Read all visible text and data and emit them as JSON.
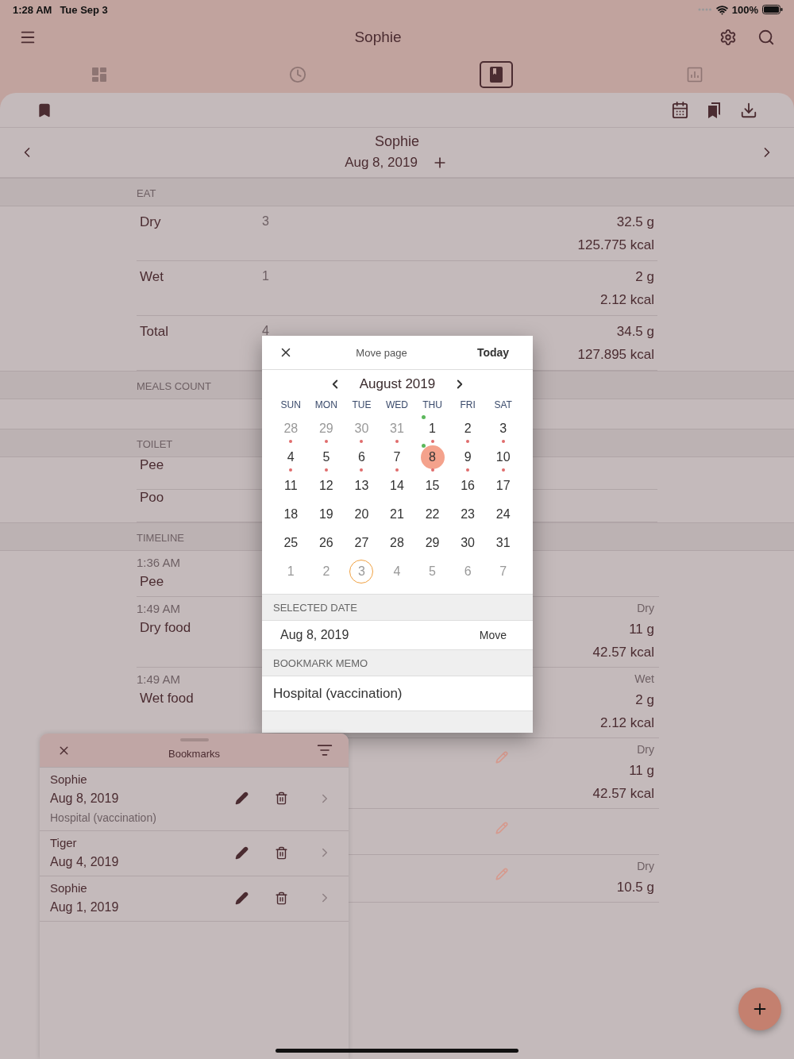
{
  "status_bar": {
    "time": "1:28 AM",
    "date": "Tue Sep 3",
    "battery": "100%"
  },
  "app_bar": {
    "title": "Sophie"
  },
  "tabs": [
    {
      "selected": false
    },
    {
      "selected": false
    },
    {
      "selected": true
    },
    {
      "selected": false
    }
  ],
  "date_header": {
    "name": "Sophie",
    "date": "Aug 8, 2019"
  },
  "sections": [
    {
      "title": "EAT",
      "kind": "food",
      "rows": [
        {
          "label": "Dry",
          "count": "3",
          "grams": "32.5 g",
          "kcal": "125.775 kcal"
        },
        {
          "label": "Wet",
          "count": "1",
          "grams": "2 g",
          "kcal": "2.12 kcal"
        },
        {
          "label": "Total",
          "count": "4",
          "grams": "34.5 g",
          "kcal": "127.895 kcal"
        }
      ]
    },
    {
      "title": "MEALS COUNT",
      "kind": "empty"
    },
    {
      "title": "TOILET",
      "kind": "list",
      "rows": [
        {
          "label": "Pee"
        },
        {
          "label": "Poo"
        }
      ]
    },
    {
      "title": "TIMELINE",
      "kind": "timeline",
      "entries": [
        {
          "time": "1:36 AM",
          "label": "Pee",
          "editable": false
        },
        {
          "time": "1:49 AM",
          "label": "Dry food",
          "type": "Dry",
          "grams": "11 g",
          "kcal": "42.57 kcal",
          "editable": false
        },
        {
          "time": "1:49 AM",
          "label": "Wet food",
          "type": "Wet",
          "grams": "2 g",
          "kcal": "2.12 kcal",
          "editable": false
        },
        {
          "type": "Dry",
          "grams": "11 g",
          "kcal": "42.57 kcal",
          "editable": true
        },
        {
          "editable": true
        },
        {
          "type": "Dry",
          "grams": "10.5 g",
          "editable": true
        }
      ]
    }
  ],
  "dialog": {
    "title": "Move page",
    "today_button": "Today",
    "month": "August 2019",
    "weekdays": [
      "SUN",
      "MON",
      "TUE",
      "WED",
      "THU",
      "FRI",
      "SAT"
    ],
    "days": [
      {
        "label": "28",
        "outside": true,
        "dot": true,
        "event": false,
        "today": false,
        "selected": false
      },
      {
        "label": "29",
        "outside": true,
        "dot": true,
        "event": false,
        "today": false,
        "selected": false
      },
      {
        "label": "30",
        "outside": true,
        "dot": true,
        "event": false,
        "today": false,
        "selected": false
      },
      {
        "label": "31",
        "outside": true,
        "dot": true,
        "event": false,
        "today": false,
        "selected": false
      },
      {
        "label": "1",
        "outside": false,
        "dot": true,
        "event": true,
        "today": false,
        "selected": false
      },
      {
        "label": "2",
        "outside": false,
        "dot": true,
        "event": false,
        "today": false,
        "selected": false
      },
      {
        "label": "3",
        "outside": false,
        "dot": true,
        "event": false,
        "today": false,
        "selected": false
      },
      {
        "label": "4",
        "outside": false,
        "dot": true,
        "event": false,
        "today": false,
        "selected": false
      },
      {
        "label": "5",
        "outside": false,
        "dot": true,
        "event": false,
        "today": false,
        "selected": false
      },
      {
        "label": "6",
        "outside": false,
        "dot": true,
        "event": false,
        "today": false,
        "selected": false
      },
      {
        "label": "7",
        "outside": false,
        "dot": true,
        "event": false,
        "today": false,
        "selected": false
      },
      {
        "label": "8",
        "outside": false,
        "dot": true,
        "event": true,
        "today": false,
        "selected": true
      },
      {
        "label": "9",
        "outside": false,
        "dot": true,
        "event": false,
        "today": false,
        "selected": false
      },
      {
        "label": "10",
        "outside": false,
        "dot": true,
        "event": false,
        "today": false,
        "selected": false
      },
      {
        "label": "11",
        "outside": false,
        "dot": false,
        "event": false,
        "today": false,
        "selected": false
      },
      {
        "label": "12",
        "outside": false,
        "dot": false,
        "event": false,
        "today": false,
        "selected": false
      },
      {
        "label": "13",
        "outside": false,
        "dot": false,
        "event": false,
        "today": false,
        "selected": false
      },
      {
        "label": "14",
        "outside": false,
        "dot": false,
        "event": false,
        "today": false,
        "selected": false
      },
      {
        "label": "15",
        "outside": false,
        "dot": false,
        "event": false,
        "today": false,
        "selected": false
      },
      {
        "label": "16",
        "outside": false,
        "dot": false,
        "event": false,
        "today": false,
        "selected": false
      },
      {
        "label": "17",
        "outside": false,
        "dot": false,
        "event": false,
        "today": false,
        "selected": false
      },
      {
        "label": "18",
        "outside": false,
        "dot": false,
        "event": false,
        "today": false,
        "selected": false
      },
      {
        "label": "19",
        "outside": false,
        "dot": false,
        "event": false,
        "today": false,
        "selected": false
      },
      {
        "label": "20",
        "outside": false,
        "dot": false,
        "event": false,
        "today": false,
        "selected": false
      },
      {
        "label": "21",
        "outside": false,
        "dot": false,
        "event": false,
        "today": false,
        "selected": false
      },
      {
        "label": "22",
        "outside": false,
        "dot": false,
        "event": false,
        "today": false,
        "selected": false
      },
      {
        "label": "23",
        "outside": false,
        "dot": false,
        "event": false,
        "today": false,
        "selected": false
      },
      {
        "label": "24",
        "outside": false,
        "dot": false,
        "event": false,
        "today": false,
        "selected": false
      },
      {
        "label": "25",
        "outside": false,
        "dot": false,
        "event": false,
        "today": false,
        "selected": false
      },
      {
        "label": "26",
        "outside": false,
        "dot": false,
        "event": false,
        "today": false,
        "selected": false
      },
      {
        "label": "27",
        "outside": false,
        "dot": false,
        "event": false,
        "today": false,
        "selected": false
      },
      {
        "label": "28",
        "outside": false,
        "dot": false,
        "event": false,
        "today": false,
        "selected": false
      },
      {
        "label": "29",
        "outside": false,
        "dot": false,
        "event": false,
        "today": false,
        "selected": false
      },
      {
        "label": "30",
        "outside": false,
        "dot": false,
        "event": false,
        "today": false,
        "selected": false
      },
      {
        "label": "31",
        "outside": false,
        "dot": false,
        "event": false,
        "today": false,
        "selected": false
      },
      {
        "label": "1",
        "outside": true,
        "dot": false,
        "event": false,
        "today": false,
        "selected": false
      },
      {
        "label": "2",
        "outside": true,
        "dot": false,
        "event": false,
        "today": false,
        "selected": false
      },
      {
        "label": "3",
        "outside": true,
        "dot": false,
        "event": false,
        "today": true,
        "selected": false
      },
      {
        "label": "4",
        "outside": true,
        "dot": false,
        "event": false,
        "today": false,
        "selected": false
      },
      {
        "label": "5",
        "outside": true,
        "dot": false,
        "event": false,
        "today": false,
        "selected": false
      },
      {
        "label": "6",
        "outside": true,
        "dot": false,
        "event": false,
        "today": false,
        "selected": false
      },
      {
        "label": "7",
        "outside": true,
        "dot": false,
        "event": false,
        "today": false,
        "selected": false
      }
    ],
    "selected_date_header": "SELECTED DATE",
    "selected_date": "Aug 8, 2019",
    "move_button": "Move",
    "memo_header": "BOOKMARK MEMO",
    "memo": "Hospital (vaccination)"
  },
  "bookmarks": {
    "title": "Bookmarks",
    "items": [
      {
        "name": "Sophie",
        "date": "Aug 8, 2019",
        "memo": "Hospital (vaccination)"
      },
      {
        "name": "Tiger",
        "date": "Aug 4, 2019"
      },
      {
        "name": "Sophie",
        "date": "Aug 1, 2019"
      }
    ]
  }
}
